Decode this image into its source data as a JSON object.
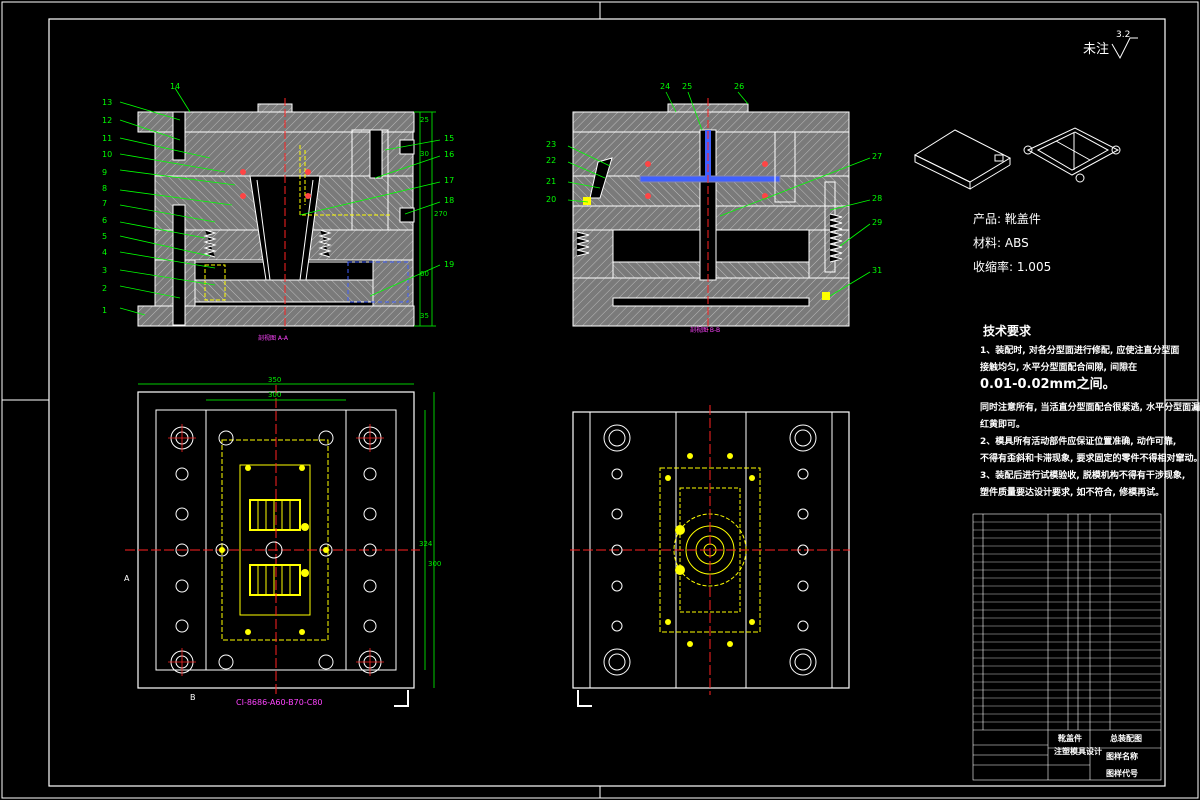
{
  "drawing": {
    "surface_mark": {
      "label": "未注",
      "value": "3.2"
    },
    "product": {
      "name": "产品: 靴盖件",
      "material": "材料: ABS",
      "shrinkage": "收缩率: 1.005"
    },
    "technical_requirements": {
      "title": "技术要求",
      "lines": [
        "1、装配时, 对各分型面进行修配, 应使注直分型面",
        "接触均匀, 水平分型面配合间隙, 间隙在",
        "0.01-0.02mm之间。",
        "同时注意所有, 当活直分型面配合很紧逃, 水平分型面漏风",
        "红黄即可。",
        "2、模具所有活动部件应保证位置准确, 动作可靠,",
        "不得有歪斜和卡滞现象, 要求固定的零件不得相对窜动。",
        "3、装配后进行试模验收, 脱模机构不得有干涉现象,",
        "塑件质量要达设计要求, 如不符合, 修模再试。"
      ]
    },
    "section_labels": {
      "left": "剖视图 A-A",
      "right": "剖视图 B-B"
    },
    "mold_base_label": "CI-8686-A60-B70-C80",
    "dimensions": {
      "width_top": "350",
      "width_inner": "300",
      "height_right": "300",
      "height_inner": "324",
      "side_270": "270",
      "side_30": "30",
      "side_60": "60",
      "side_25": "25",
      "side_35": "35"
    },
    "view_markers": {
      "a": "A",
      "b": "B"
    },
    "part_numbers_left": [
      "1",
      "2",
      "3",
      "4",
      "5",
      "6",
      "7",
      "8",
      "9",
      "10",
      "11",
      "12",
      "13",
      "14",
      "15",
      "16",
      "17",
      "18",
      "19"
    ],
    "part_numbers_right": [
      "20",
      "21",
      "22",
      "23",
      "24",
      "25",
      "26",
      "27",
      "28",
      "29",
      "31"
    ],
    "title_block": {
      "part_title": "靴盖件",
      "design_title": "注塑模具设计",
      "drawing_name": "总装配图",
      "drawing_code": "图样代号",
      "drawing_sheet": "图样名称"
    },
    "colors": {
      "background": "#000000",
      "frame": "#ffffff",
      "section_fill": "#8a8a8a",
      "centerline": "#ff2020",
      "hidden": "#ffff00",
      "dimension": "#00e000",
      "leader": "#00ff00",
      "annotation_pink": "#ff40ff",
      "cavity": "#4060ff"
    }
  }
}
